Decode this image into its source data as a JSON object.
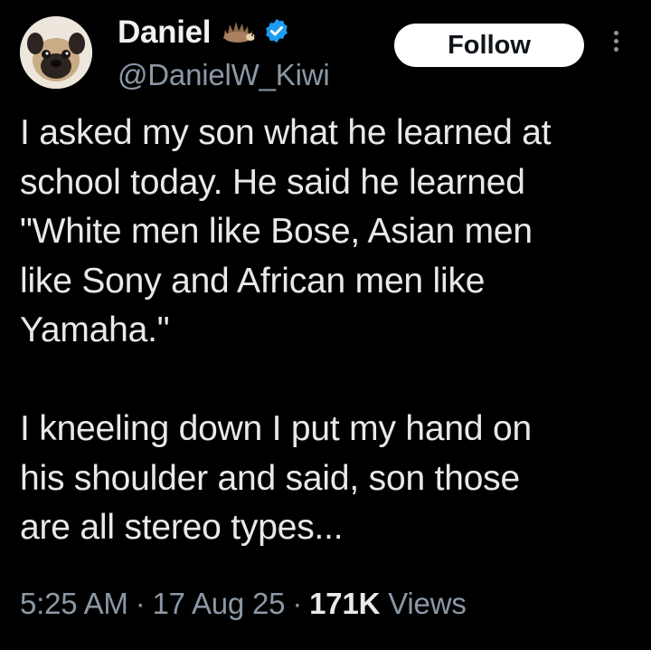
{
  "author": {
    "display_name": "Daniel",
    "handle": "@DanielW_Kiwi",
    "emoji_icon": "hedgehog-icon",
    "verified_icon": "verified-badge-icon",
    "verified_color": "#1d9bf0",
    "avatar_icon": "pug-avatar-icon"
  },
  "actions": {
    "follow_label": "Follow",
    "more_icon": "more-options-icon"
  },
  "tweet": {
    "paragraph_1": [
      "I asked my son what he learned at",
      "school today. He said he learned",
      "\"White men like Bose, Asian men",
      "like Sony and African men like",
      "Yamaha.\""
    ],
    "paragraph_2": [
      "I kneeling down I put my hand on",
      "his shoulder and said, son those",
      "are all stereo types..."
    ]
  },
  "meta": {
    "time": "5:25 AM",
    "date": "17 Aug 25",
    "views_count": "171K",
    "views_label": "Views",
    "separator": "·"
  },
  "colors": {
    "background": "#000000",
    "text_primary": "#e7e9ea",
    "text_secondary": "#8b98a5",
    "button_bg": "#ffffff"
  }
}
